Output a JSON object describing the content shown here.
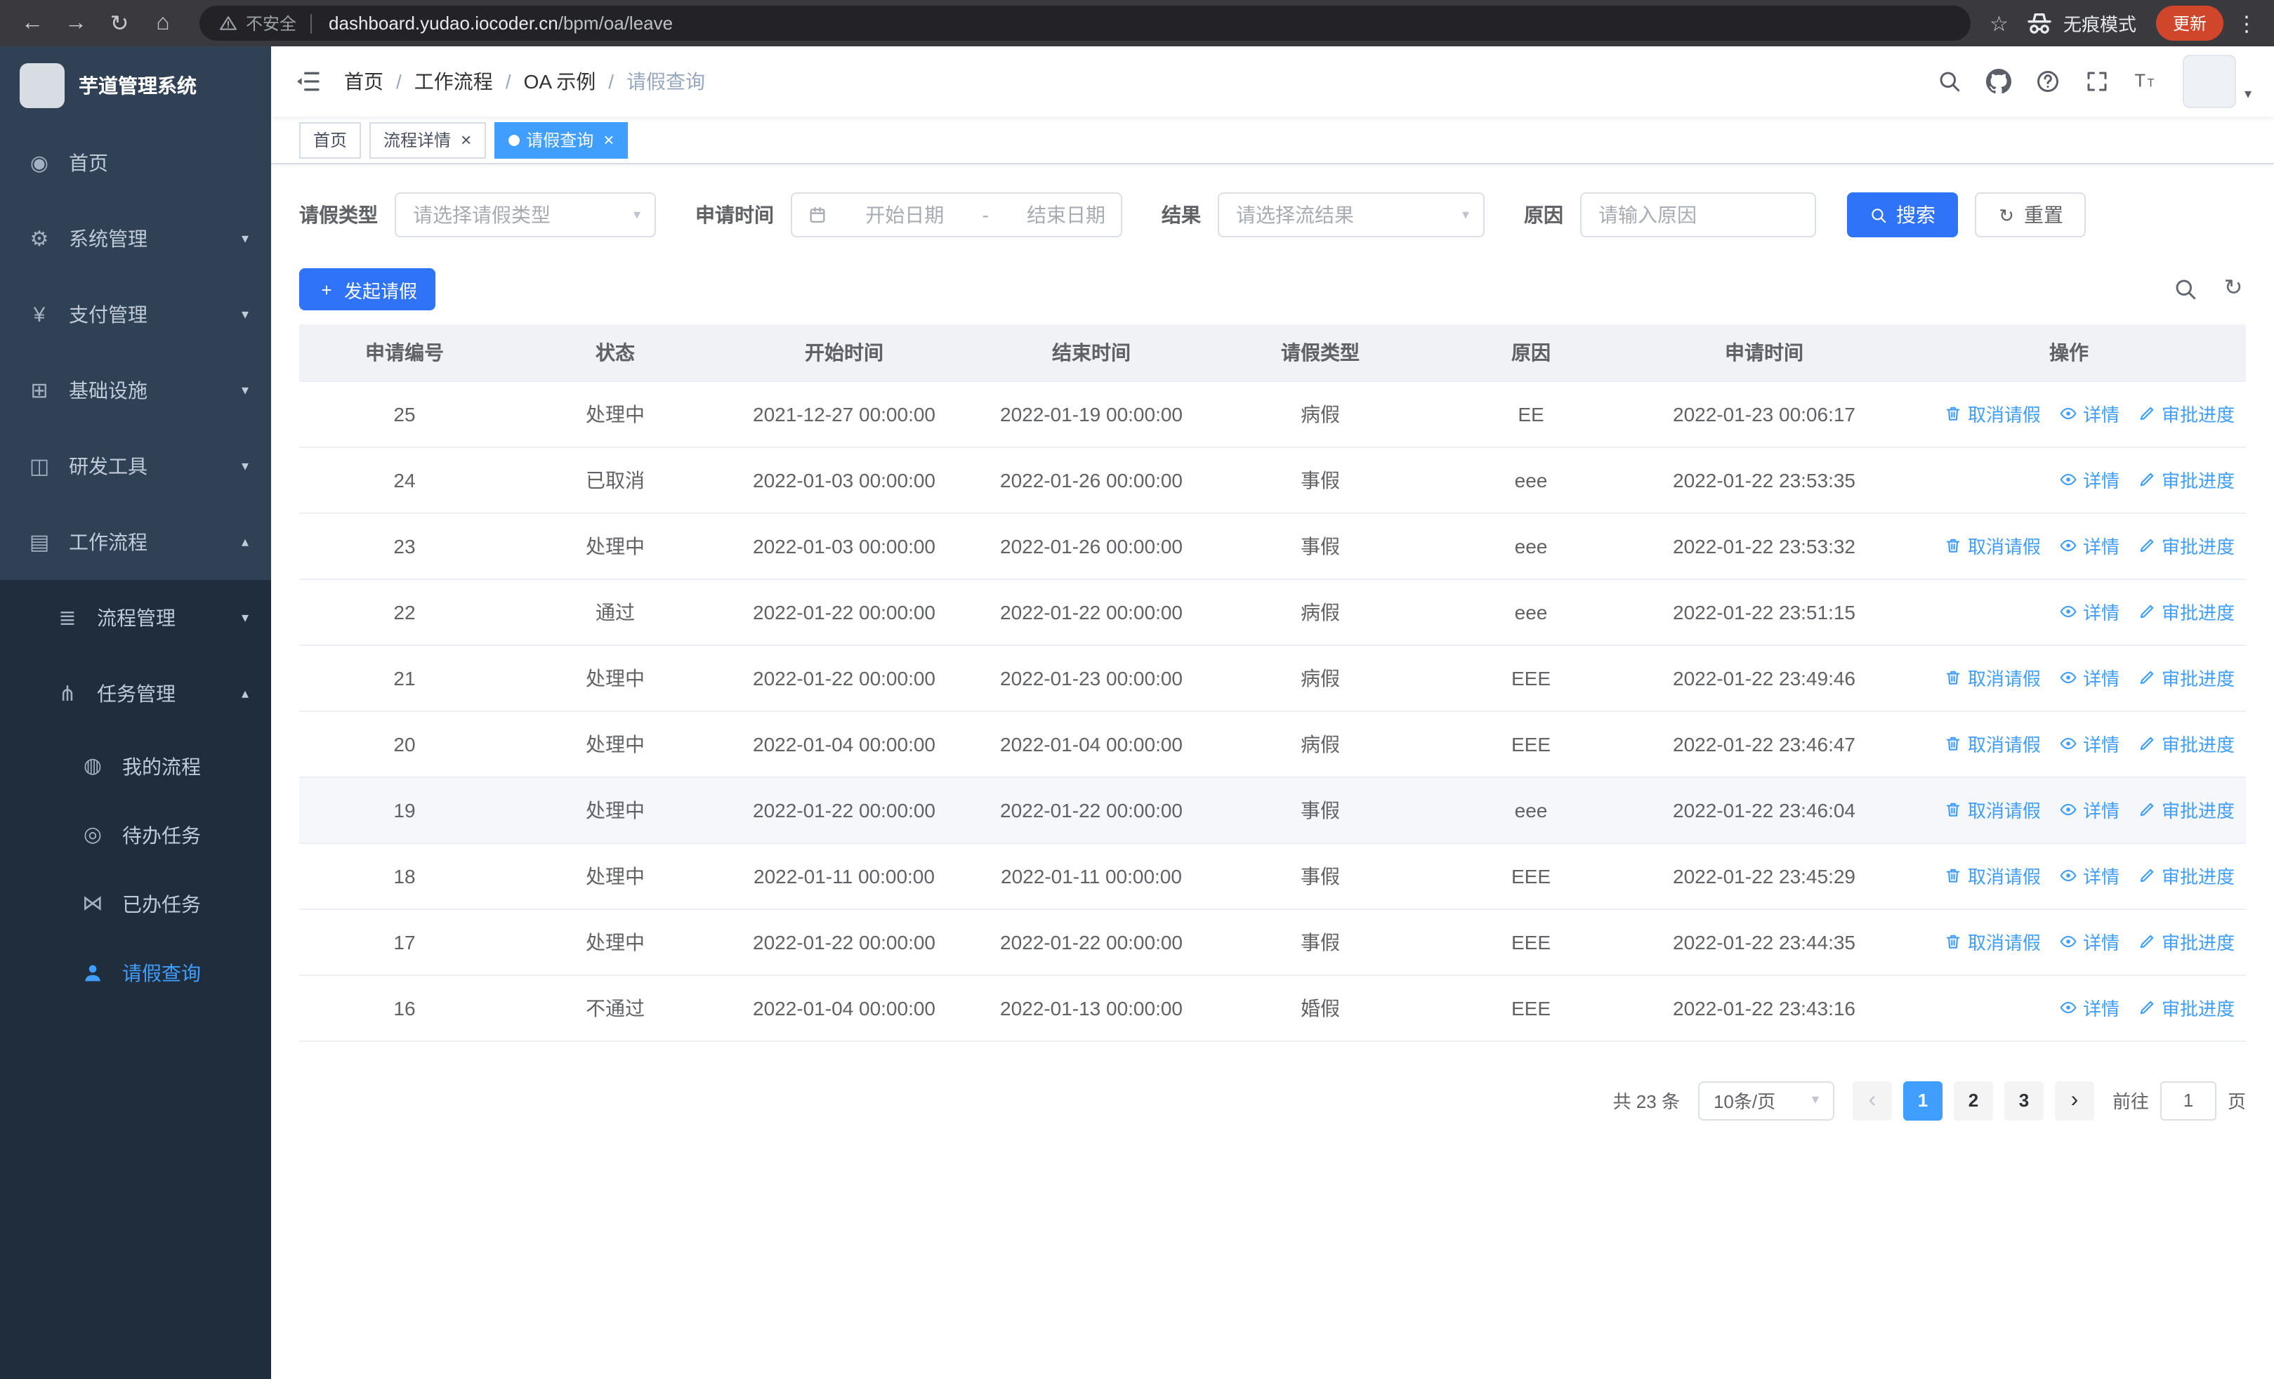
{
  "browser": {
    "security_warning": "不安全",
    "url_domain": "dashboard.yudao.iocoder.cn",
    "url_path": "/bpm/oa/leave",
    "incognito_label": "无痕模式",
    "update_label": "更新"
  },
  "app": {
    "title": "芋道管理系统"
  },
  "colors": {
    "primary": "#409EFF",
    "button_primary": "#2E73F8",
    "sidebar_bg": "#304156",
    "submenu_bg": "#1F2D3D",
    "update_badge": "#D0462B"
  },
  "sidebar": {
    "items": [
      {
        "key": "home",
        "label": "首页",
        "icon": "dashboard-icon",
        "level": 1
      },
      {
        "key": "system-management",
        "label": "系统管理",
        "icon": "gear-icon",
        "level": 1,
        "chevron": "down"
      },
      {
        "key": "payment-management",
        "label": "支付管理",
        "icon": "yen-icon",
        "level": 1,
        "chevron": "down"
      },
      {
        "key": "infrastructure",
        "label": "基础设施",
        "icon": "monitor-icon",
        "level": 1,
        "chevron": "down"
      },
      {
        "key": "dev-tools",
        "label": "研发工具",
        "icon": "toolbox-icon",
        "level": 1,
        "chevron": "down"
      },
      {
        "key": "workflow",
        "label": "工作流程",
        "icon": "briefcase-icon",
        "level": 1,
        "chevron": "up"
      },
      {
        "key": "process-management",
        "label": "流程管理",
        "icon": "list-icon",
        "level": 2,
        "chevron": "down"
      },
      {
        "key": "task-management",
        "label": "任务管理",
        "icon": "branch-icon",
        "level": 2,
        "chevron": "up"
      },
      {
        "key": "my-process",
        "label": "我的流程",
        "icon": "chat-icon",
        "level": 3
      },
      {
        "key": "todo-tasks",
        "label": "待办任务",
        "icon": "watch-icon",
        "level": 3
      },
      {
        "key": "done-tasks",
        "label": "已办任务",
        "icon": "bowtie-icon",
        "level": 3
      },
      {
        "key": "leave-query",
        "label": "请假查询",
        "icon": "person-icon",
        "level": 3,
        "active": true
      }
    ]
  },
  "breadcrumb": {
    "items": [
      "首页",
      "工作流程",
      "OA 示例",
      "请假查询"
    ],
    "separator": "/"
  },
  "tags_view": {
    "tabs": [
      {
        "key": "home",
        "label": "首页"
      },
      {
        "key": "process-detail",
        "label": "流程详情",
        "closable": true
      },
      {
        "key": "leave-query",
        "label": "请假查询",
        "closable": true,
        "active": true
      }
    ]
  },
  "filters": {
    "leave_type_label": "请假类型",
    "leave_type_placeholder": "请选择请假类型",
    "apply_time_label": "申请时间",
    "start_date_placeholder": "开始日期",
    "range_separator": "-",
    "end_date_placeholder": "结束日期",
    "result_label": "结果",
    "result_placeholder": "请选择流结果",
    "reason_label": "原因",
    "reason_placeholder": "请输入原因",
    "search_label": "搜索",
    "reset_label": "重置"
  },
  "toolbar": {
    "create_label": "发起请假"
  },
  "table": {
    "columns": [
      "申请编号",
      "状态",
      "开始时间",
      "结束时间",
      "请假类型",
      "原因",
      "申请时间",
      "操作"
    ],
    "action_labels": {
      "cancel": "取消请假",
      "detail": "详情",
      "progress": "审批进度"
    },
    "rows": [
      {
        "id": "25",
        "status": "处理中",
        "start": "2021-12-27 00:00:00",
        "end": "2022-01-19 00:00:00",
        "type": "病假",
        "reason": "EE",
        "apply_time": "2022-01-23 00:06:17",
        "actions": [
          "cancel",
          "detail",
          "progress"
        ]
      },
      {
        "id": "24",
        "status": "已取消",
        "start": "2022-01-03 00:00:00",
        "end": "2022-01-26 00:00:00",
        "type": "事假",
        "reason": "eee",
        "apply_time": "2022-01-22 23:53:35",
        "actions": [
          "detail",
          "progress"
        ]
      },
      {
        "id": "23",
        "status": "处理中",
        "start": "2022-01-03 00:00:00",
        "end": "2022-01-26 00:00:00",
        "type": "事假",
        "reason": "eee",
        "apply_time": "2022-01-22 23:53:32",
        "actions": [
          "cancel",
          "detail",
          "progress"
        ]
      },
      {
        "id": "22",
        "status": "通过",
        "start": "2022-01-22 00:00:00",
        "end": "2022-01-22 00:00:00",
        "type": "病假",
        "reason": "eee",
        "apply_time": "2022-01-22 23:51:15",
        "actions": [
          "detail",
          "progress"
        ]
      },
      {
        "id": "21",
        "status": "处理中",
        "start": "2022-01-22 00:00:00",
        "end": "2022-01-23 00:00:00",
        "type": "病假",
        "reason": "EEE",
        "apply_time": "2022-01-22 23:49:46",
        "actions": [
          "cancel",
          "detail",
          "progress"
        ]
      },
      {
        "id": "20",
        "status": "处理中",
        "start": "2022-01-04 00:00:00",
        "end": "2022-01-04 00:00:00",
        "type": "病假",
        "reason": "EEE",
        "apply_time": "2022-01-22 23:46:47",
        "actions": [
          "cancel",
          "detail",
          "progress"
        ]
      },
      {
        "id": "19",
        "status": "处理中",
        "start": "2022-01-22 00:00:00",
        "end": "2022-01-22 00:00:00",
        "type": "事假",
        "reason": "eee",
        "apply_time": "2022-01-22 23:46:04",
        "actions": [
          "cancel",
          "detail",
          "progress"
        ],
        "highlighted": true
      },
      {
        "id": "18",
        "status": "处理中",
        "start": "2022-01-11 00:00:00",
        "end": "2022-01-11 00:00:00",
        "type": "事假",
        "reason": "EEE",
        "apply_time": "2022-01-22 23:45:29",
        "actions": [
          "cancel",
          "detail",
          "progress"
        ]
      },
      {
        "id": "17",
        "status": "处理中",
        "start": "2022-01-22 00:00:00",
        "end": "2022-01-22 00:00:00",
        "type": "事假",
        "reason": "EEE",
        "apply_time": "2022-01-22 23:44:35",
        "actions": [
          "cancel",
          "detail",
          "progress"
        ]
      },
      {
        "id": "16",
        "status": "不通过",
        "start": "2022-01-04 00:00:00",
        "end": "2022-01-13 00:00:00",
        "type": "婚假",
        "reason": "EEE",
        "apply_time": "2022-01-22 23:43:16",
        "actions": [
          "detail",
          "progress"
        ]
      }
    ]
  },
  "pagination": {
    "total_label": "共 23 条",
    "page_size_label": "10条/页",
    "pages": [
      "1",
      "2",
      "3"
    ],
    "active_page": "1",
    "goto_label": "前往",
    "goto_value": "1",
    "goto_suffix": "页"
  }
}
